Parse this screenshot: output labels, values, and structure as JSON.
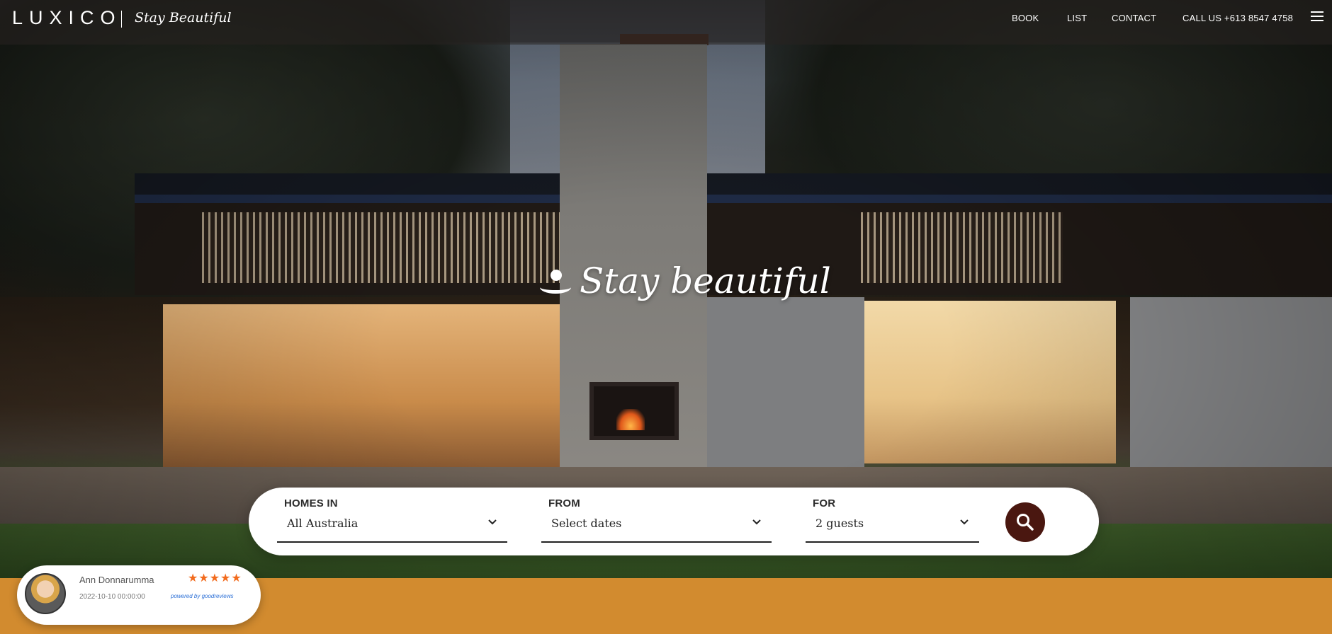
{
  "header": {
    "logo": "LUXICO",
    "tagline": "Stay Beautiful",
    "nav": [
      {
        "label": "BOOK"
      },
      {
        "label": "LIST"
      },
      {
        "label": "CONTACT"
      },
      {
        "label": "CALL US +613 8547 4758"
      }
    ],
    "menu_icon": "hamburger-icon"
  },
  "hero": {
    "headline": "Stay beautiful",
    "headline_icon": "luxico-figure-icon"
  },
  "search": {
    "fields": [
      {
        "label": "HOMES IN",
        "value": "All Australia"
      },
      {
        "label": "FROM",
        "value": "Select dates"
      },
      {
        "label": "FOR",
        "value": "2 guests"
      }
    ],
    "button_icon": "search-icon",
    "button_color": "#4a1710"
  },
  "review": {
    "name": "Ann Donnarumma",
    "date": "2022-10-10 00:00:00",
    "stars": "★★★★★",
    "rating": 5,
    "powered_by": "powered by goodreviews"
  },
  "colors": {
    "accent_band": "#d28b2f",
    "star": "#f26b1d"
  }
}
